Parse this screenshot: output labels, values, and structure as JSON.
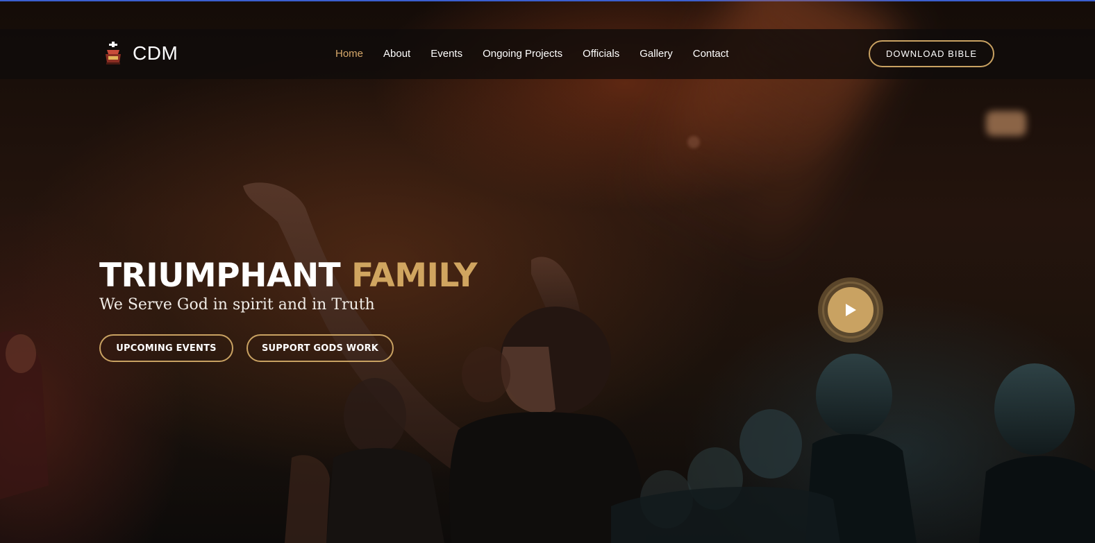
{
  "site": {
    "logo_text": "CDM",
    "logo_icon": "church-logo-icon"
  },
  "nav": {
    "items": [
      {
        "label": "Home",
        "active": true
      },
      {
        "label": "About",
        "active": false
      },
      {
        "label": "Events",
        "active": false
      },
      {
        "label": "Ongoing Projects",
        "active": false
      },
      {
        "label": "Officials",
        "active": false
      },
      {
        "label": "Gallery",
        "active": false
      },
      {
        "label": "Contact",
        "active": false
      }
    ],
    "cta_label": "DOWNLOAD BIBLE"
  },
  "hero": {
    "title_main": "TRIUMPHANT",
    "title_accent": "FAMILY",
    "subtitle": "We Serve God in spirit and in Truth",
    "buttons": [
      {
        "label": "UPCOMING EVENTS"
      },
      {
        "label": "SUPPORT GODS WORK"
      }
    ],
    "play_icon": "play-icon"
  },
  "colors": {
    "accent": "#c9a262",
    "nav_active": "#d7a86a",
    "top_line": "#3a5fd0"
  }
}
